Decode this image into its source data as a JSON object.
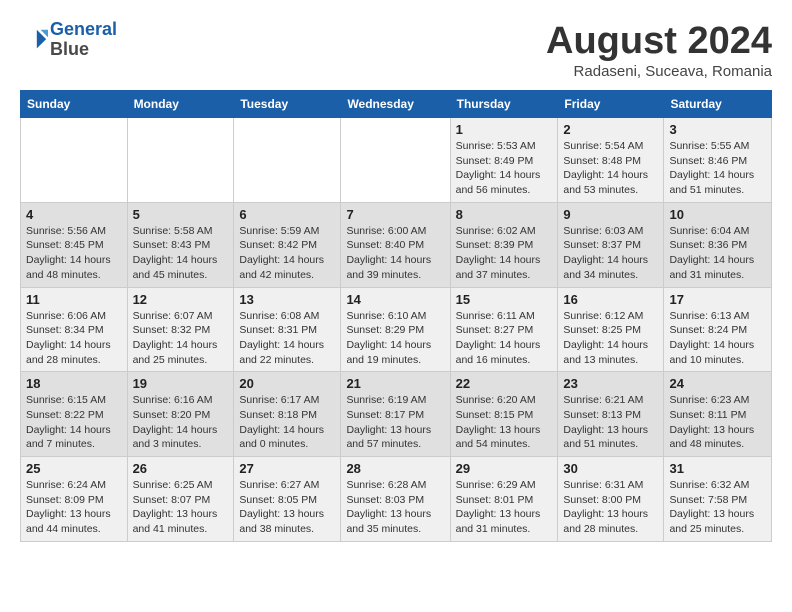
{
  "header": {
    "logo_line1": "General",
    "logo_line2": "Blue",
    "month": "August 2024",
    "location": "Radaseni, Suceava, Romania"
  },
  "weekdays": [
    "Sunday",
    "Monday",
    "Tuesday",
    "Wednesday",
    "Thursday",
    "Friday",
    "Saturday"
  ],
  "weeks": [
    [
      {
        "day": "",
        "info": ""
      },
      {
        "day": "",
        "info": ""
      },
      {
        "day": "",
        "info": ""
      },
      {
        "day": "",
        "info": ""
      },
      {
        "day": "1",
        "info": "Sunrise: 5:53 AM\nSunset: 8:49 PM\nDaylight: 14 hours\nand 56 minutes."
      },
      {
        "day": "2",
        "info": "Sunrise: 5:54 AM\nSunset: 8:48 PM\nDaylight: 14 hours\nand 53 minutes."
      },
      {
        "day": "3",
        "info": "Sunrise: 5:55 AM\nSunset: 8:46 PM\nDaylight: 14 hours\nand 51 minutes."
      }
    ],
    [
      {
        "day": "4",
        "info": "Sunrise: 5:56 AM\nSunset: 8:45 PM\nDaylight: 14 hours\nand 48 minutes."
      },
      {
        "day": "5",
        "info": "Sunrise: 5:58 AM\nSunset: 8:43 PM\nDaylight: 14 hours\nand 45 minutes."
      },
      {
        "day": "6",
        "info": "Sunrise: 5:59 AM\nSunset: 8:42 PM\nDaylight: 14 hours\nand 42 minutes."
      },
      {
        "day": "7",
        "info": "Sunrise: 6:00 AM\nSunset: 8:40 PM\nDaylight: 14 hours\nand 39 minutes."
      },
      {
        "day": "8",
        "info": "Sunrise: 6:02 AM\nSunset: 8:39 PM\nDaylight: 14 hours\nand 37 minutes."
      },
      {
        "day": "9",
        "info": "Sunrise: 6:03 AM\nSunset: 8:37 PM\nDaylight: 14 hours\nand 34 minutes."
      },
      {
        "day": "10",
        "info": "Sunrise: 6:04 AM\nSunset: 8:36 PM\nDaylight: 14 hours\nand 31 minutes."
      }
    ],
    [
      {
        "day": "11",
        "info": "Sunrise: 6:06 AM\nSunset: 8:34 PM\nDaylight: 14 hours\nand 28 minutes."
      },
      {
        "day": "12",
        "info": "Sunrise: 6:07 AM\nSunset: 8:32 PM\nDaylight: 14 hours\nand 25 minutes."
      },
      {
        "day": "13",
        "info": "Sunrise: 6:08 AM\nSunset: 8:31 PM\nDaylight: 14 hours\nand 22 minutes."
      },
      {
        "day": "14",
        "info": "Sunrise: 6:10 AM\nSunset: 8:29 PM\nDaylight: 14 hours\nand 19 minutes."
      },
      {
        "day": "15",
        "info": "Sunrise: 6:11 AM\nSunset: 8:27 PM\nDaylight: 14 hours\nand 16 minutes."
      },
      {
        "day": "16",
        "info": "Sunrise: 6:12 AM\nSunset: 8:25 PM\nDaylight: 14 hours\nand 13 minutes."
      },
      {
        "day": "17",
        "info": "Sunrise: 6:13 AM\nSunset: 8:24 PM\nDaylight: 14 hours\nand 10 minutes."
      }
    ],
    [
      {
        "day": "18",
        "info": "Sunrise: 6:15 AM\nSunset: 8:22 PM\nDaylight: 14 hours\nand 7 minutes."
      },
      {
        "day": "19",
        "info": "Sunrise: 6:16 AM\nSunset: 8:20 PM\nDaylight: 14 hours\nand 3 minutes."
      },
      {
        "day": "20",
        "info": "Sunrise: 6:17 AM\nSunset: 8:18 PM\nDaylight: 14 hours\nand 0 minutes."
      },
      {
        "day": "21",
        "info": "Sunrise: 6:19 AM\nSunset: 8:17 PM\nDaylight: 13 hours\nand 57 minutes."
      },
      {
        "day": "22",
        "info": "Sunrise: 6:20 AM\nSunset: 8:15 PM\nDaylight: 13 hours\nand 54 minutes."
      },
      {
        "day": "23",
        "info": "Sunrise: 6:21 AM\nSunset: 8:13 PM\nDaylight: 13 hours\nand 51 minutes."
      },
      {
        "day": "24",
        "info": "Sunrise: 6:23 AM\nSunset: 8:11 PM\nDaylight: 13 hours\nand 48 minutes."
      }
    ],
    [
      {
        "day": "25",
        "info": "Sunrise: 6:24 AM\nSunset: 8:09 PM\nDaylight: 13 hours\nand 44 minutes."
      },
      {
        "day": "26",
        "info": "Sunrise: 6:25 AM\nSunset: 8:07 PM\nDaylight: 13 hours\nand 41 minutes."
      },
      {
        "day": "27",
        "info": "Sunrise: 6:27 AM\nSunset: 8:05 PM\nDaylight: 13 hours\nand 38 minutes."
      },
      {
        "day": "28",
        "info": "Sunrise: 6:28 AM\nSunset: 8:03 PM\nDaylight: 13 hours\nand 35 minutes."
      },
      {
        "day": "29",
        "info": "Sunrise: 6:29 AM\nSunset: 8:01 PM\nDaylight: 13 hours\nand 31 minutes."
      },
      {
        "day": "30",
        "info": "Sunrise: 6:31 AM\nSunset: 8:00 PM\nDaylight: 13 hours\nand 28 minutes."
      },
      {
        "day": "31",
        "info": "Sunrise: 6:32 AM\nSunset: 7:58 PM\nDaylight: 13 hours\nand 25 minutes."
      }
    ]
  ]
}
